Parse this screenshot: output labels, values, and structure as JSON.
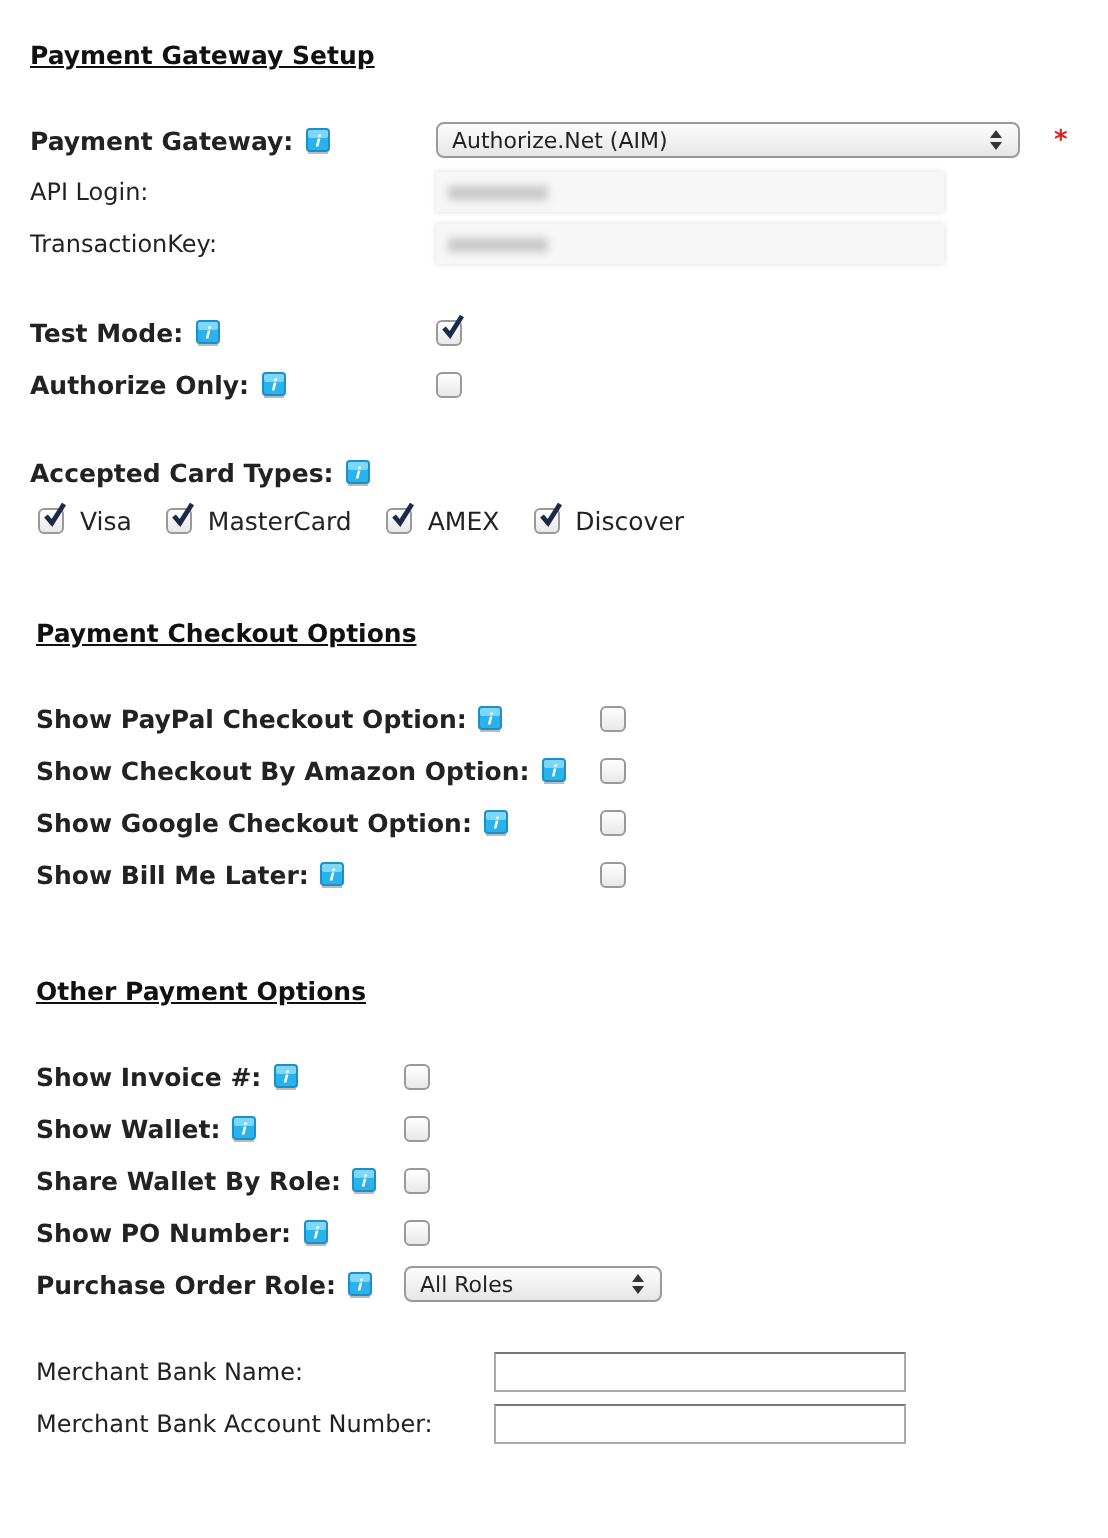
{
  "sections": [
    {
      "title": "Payment Gateway Setup",
      "groups": [
        [
          {
            "kind": "select",
            "label": "Payment Gateway:",
            "info": true,
            "value": "Authorize.Net (AIM)",
            "required_mark": "*"
          },
          {
            "kind": "text",
            "label": "API Login:",
            "masked": true
          },
          {
            "kind": "text",
            "label": "TransactionKey:",
            "masked": true
          }
        ],
        [
          {
            "kind": "checkbox",
            "label": "Test Mode:",
            "info": true,
            "checked": true
          },
          {
            "kind": "checkbox",
            "label": "Authorize Only:",
            "info": true,
            "checked": false
          }
        ],
        [
          {
            "kind": "heading",
            "label": "Accepted Card Types:",
            "info": true
          },
          {
            "kind": "options",
            "items": [
              {
                "label": "Visa",
                "checked": true
              },
              {
                "label": "MasterCard",
                "checked": true
              },
              {
                "label": "AMEX",
                "checked": true
              },
              {
                "label": "Discover",
                "checked": true
              }
            ]
          }
        ]
      ]
    },
    {
      "title": "Payment Checkout Options",
      "groups": [
        [
          {
            "kind": "checkbox",
            "label": "Show PayPal Checkout Option:",
            "info": true,
            "checked": false
          },
          {
            "kind": "checkbox",
            "label": "Show Checkout By Amazon Option:",
            "info": true,
            "checked": false
          },
          {
            "kind": "checkbox",
            "label": "Show Google Checkout Option:",
            "info": true,
            "checked": false
          },
          {
            "kind": "checkbox",
            "label": "Show Bill Me Later:",
            "info": true,
            "checked": false
          }
        ]
      ]
    },
    {
      "title": "Other Payment Options",
      "groups": [
        [
          {
            "kind": "checkbox",
            "label": "Show Invoice #:",
            "info": true,
            "checked": false
          },
          {
            "kind": "checkbox",
            "label": "Show Wallet:",
            "info": true,
            "checked": false
          },
          {
            "kind": "checkbox",
            "label": "Share Wallet By Role:",
            "info": true,
            "checked": false
          },
          {
            "kind": "checkbox",
            "label": "Show PO Number:",
            "info": true,
            "checked": false
          },
          {
            "kind": "select",
            "label": "Purchase Order Role:",
            "info": true,
            "value": "All Roles"
          }
        ],
        [
          {
            "kind": "text",
            "label": "Merchant Bank Name:",
            "masked": false
          },
          {
            "kind": "text",
            "label": "Merchant Bank Account Number:",
            "masked": false
          }
        ]
      ]
    }
  ]
}
